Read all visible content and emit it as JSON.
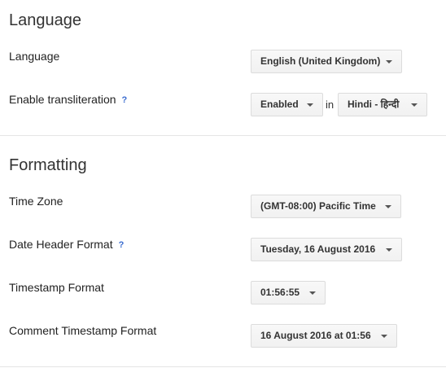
{
  "language_section": {
    "title": "Language",
    "language": {
      "label": "Language",
      "value": "English (United Kingdom)"
    },
    "transliteration": {
      "label": "Enable transliteration",
      "help": "?",
      "enabled_value": "Enabled",
      "connector": "in",
      "script_value": "Hindi - हिन्दी"
    }
  },
  "formatting_section": {
    "title": "Formatting",
    "time_zone": {
      "label": "Time Zone",
      "value": "(GMT-08:00) Pacific Time"
    },
    "date_header_format": {
      "label": "Date Header Format",
      "help": "?",
      "value": "Tuesday, 16 August 2016"
    },
    "timestamp_format": {
      "label": "Timestamp Format",
      "value": "01:56:55"
    },
    "comment_timestamp_format": {
      "label": "Comment Timestamp Format",
      "value": "16 August 2016 at 01:56"
    }
  },
  "icons": {
    "dropdown_caret": "chevron-down-icon",
    "help": "help-icon"
  },
  "colors": {
    "help_icon": "#3a6ccf",
    "divider": "#e5e5e5",
    "dropdown_border": "#dcdcdc"
  }
}
